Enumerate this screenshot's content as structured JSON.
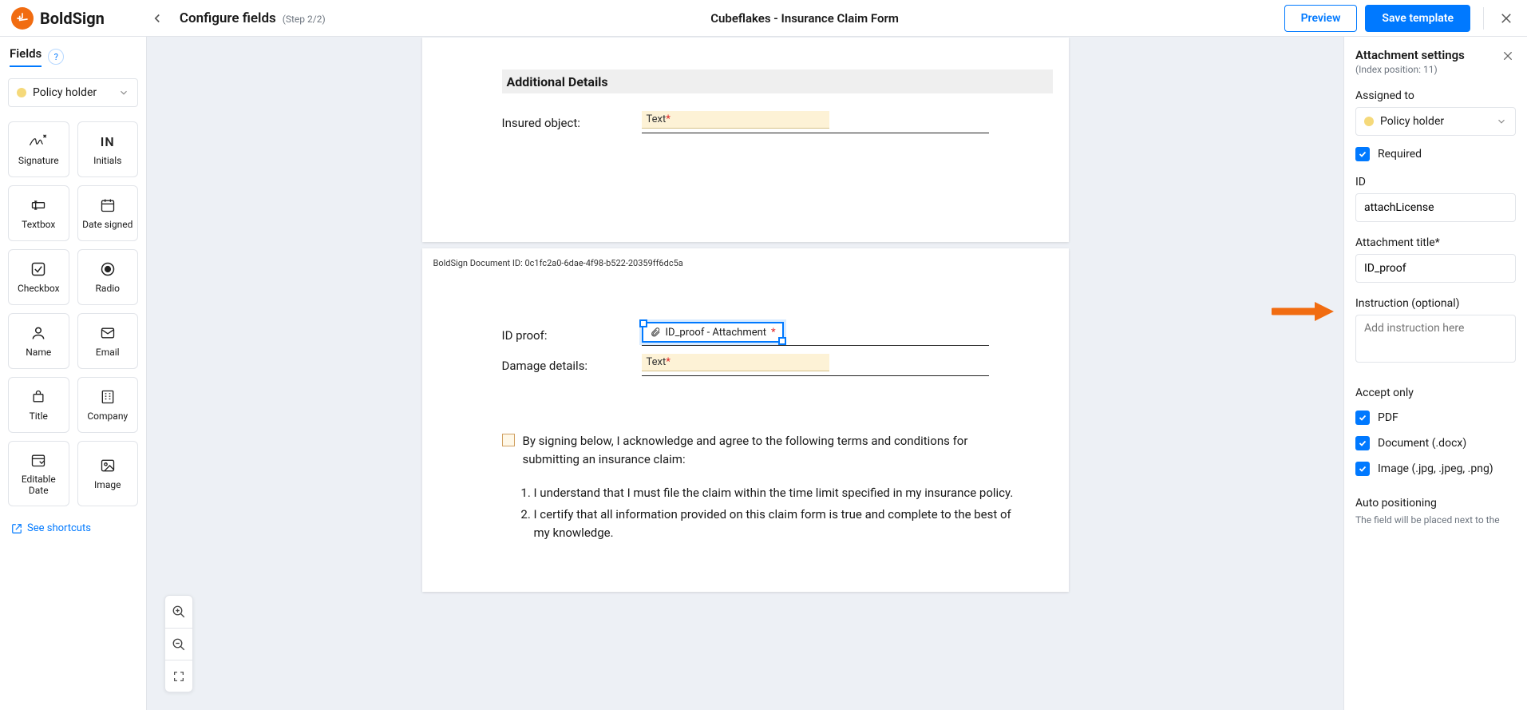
{
  "brand": {
    "name": "BoldSign"
  },
  "header": {
    "title": "Configure fields",
    "step": "(Step 2/2)",
    "document_title": "Cubeflakes - Insurance Claim Form",
    "preview": "Preview",
    "save": "Save template"
  },
  "sidebar": {
    "title": "Fields",
    "signer": "Policy holder",
    "tiles": [
      {
        "label": "Signature",
        "icon": "signature-icon"
      },
      {
        "label": "Initials",
        "icon": "initials-icon"
      },
      {
        "label": "Textbox",
        "icon": "textbox-icon"
      },
      {
        "label": "Date signed",
        "icon": "date-signed-icon"
      },
      {
        "label": "Checkbox",
        "icon": "checkbox-icon"
      },
      {
        "label": "Radio",
        "icon": "radio-icon"
      },
      {
        "label": "Name",
        "icon": "name-icon"
      },
      {
        "label": "Email",
        "icon": "email-icon"
      },
      {
        "label": "Title",
        "icon": "title-icon"
      },
      {
        "label": "Company",
        "icon": "company-icon"
      },
      {
        "label": "Editable Date",
        "icon": "editable-date-icon"
      },
      {
        "label": "Image",
        "icon": "image-icon"
      }
    ],
    "shortcuts": "See shortcuts"
  },
  "document": {
    "section_heading": "Additional Details",
    "rows": {
      "insured_object": {
        "label": "Insured object:",
        "placeholder": "Text"
      },
      "id_proof": {
        "label": "ID proof:",
        "attachment_label": "ID_proof - Attachment"
      },
      "damage_details": {
        "label": "Damage details:",
        "placeholder": "Text"
      }
    },
    "doc_id": "BoldSign Document ID: 0c1fc2a0-6dae-4f98-b522-20359ff6dc5a",
    "terms": {
      "intro": "By signing below, I acknowledge and agree to the following terms and conditions for submitting an   insurance claim:",
      "items": [
        "I understand that I must file the claim within the time limit specified in my insurance policy.",
        "I certify that all information provided on this claim form is true and complete to the best of my knowledge."
      ]
    }
  },
  "settings": {
    "title": "Attachment settings",
    "index_label": "(Index position: 11)",
    "assigned_to_label": "Assigned to",
    "assigned_to_value": "Policy holder",
    "required_label": "Required",
    "id_label": "ID",
    "id_value": "attachLicense",
    "attachment_title_label": "Attachment title*",
    "attachment_title_value": "ID_proof",
    "instruction_label": "Instruction (optional)",
    "instruction_placeholder": "Add instruction here",
    "accept_only_label": "Accept only",
    "accept_pdf": "PDF",
    "accept_docx": "Document (.docx)",
    "accept_img": "Image (.jpg, .jpeg, .png)",
    "auto_pos_label": "Auto positioning",
    "auto_pos_hint": "The field will be placed next to the"
  }
}
